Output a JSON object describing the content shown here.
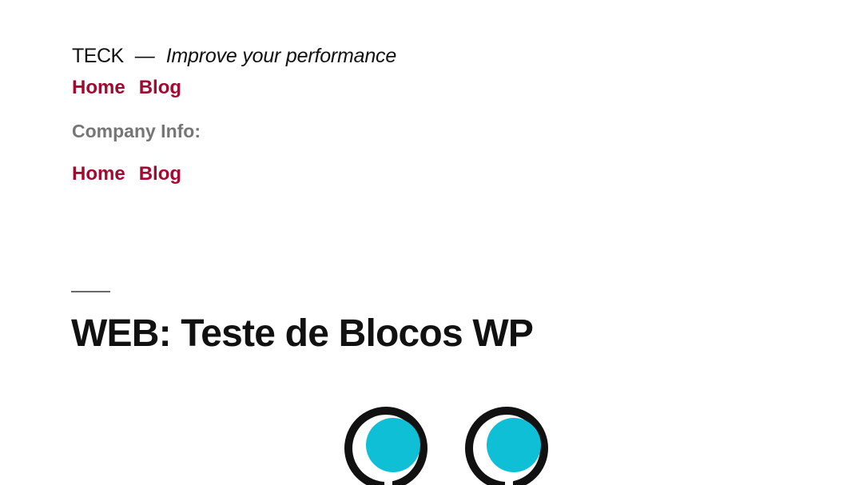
{
  "header": {
    "site_title": "TECK",
    "separator": "—",
    "site_description": "Improve your performance"
  },
  "primary_menu": {
    "items": [
      {
        "label": "Home"
      },
      {
        "label": "Blog"
      }
    ]
  },
  "company_info": {
    "heading": "Company Info:"
  },
  "secondary_menu": {
    "items": [
      {
        "label": "Home"
      },
      {
        "label": "Blog"
      }
    ]
  },
  "post": {
    "title": "WEB: Teste de Blocos WP"
  },
  "colors": {
    "link": "#a30a2f",
    "heading": "#111111",
    "muted": "#767676",
    "logo_accent": "#0ebfd6",
    "logo_dark": "#111111"
  },
  "icons": {
    "featured_image": "two-ring-glyphs-logo"
  }
}
